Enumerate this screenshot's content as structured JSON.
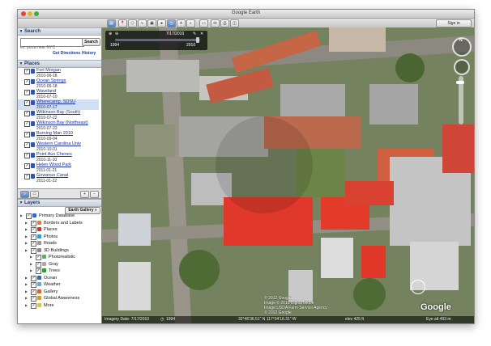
{
  "window": {
    "title": "Google Earth",
    "sign_in": "Sign in"
  },
  "search": {
    "header": "Search",
    "placeholder": "",
    "button": "Search",
    "hint": "ex: pizza near NYC",
    "get_directions": "Get Directions",
    "history": "History"
  },
  "places": {
    "header": "Places",
    "items": [
      {
        "name": "Fort Morgan",
        "date": "2010-06-18"
      },
      {
        "name": "Ocean Springs",
        "date": "2010-06-18"
      },
      {
        "name": "Waveland",
        "date": "2010-07-10"
      },
      {
        "name": "Wherecamp, SDSU",
        "date": "2010-07-17",
        "selected": true
      },
      {
        "name": "Wilkinson Bay (South)",
        "date": "2010-07-22"
      },
      {
        "name": "Wilkinson Bay (Northeast)",
        "date": "2010-07-22"
      },
      {
        "name": "Burning Man 2010",
        "date": "2010-09-04"
      },
      {
        "name": "Western Carolina Univ",
        "date": "2010-10-01"
      },
      {
        "name": "Point Aux Chenes",
        "date": "2010-11-10"
      },
      {
        "name": "Helen Wood Park",
        "date": "2011-01-21"
      },
      {
        "name": "Gowanus Canal",
        "date": "2011-01-22"
      }
    ]
  },
  "layers": {
    "header": "Layers",
    "gallery_button": "Earth Gallery »",
    "items": [
      {
        "label": "Primary Database",
        "level": 0,
        "icon_color": "#3366cc"
      },
      {
        "label": "Borders and Labels",
        "level": 1,
        "icon_color": "#cc8833"
      },
      {
        "label": "Places",
        "level": 1,
        "icon_color": "#cc3333"
      },
      {
        "label": "Photos",
        "level": 1,
        "icon_color": "#3399cc"
      },
      {
        "label": "Roads",
        "level": 1,
        "icon_color": "#999999"
      },
      {
        "label": "3D Buildings",
        "level": 1,
        "icon_color": "#888888"
      },
      {
        "label": "Photorealistic",
        "level": 2,
        "icon_color": "#66aa66"
      },
      {
        "label": "Gray",
        "level": 2,
        "icon_color": "#aaaaaa"
      },
      {
        "label": "Trees",
        "level": 2,
        "icon_color": "#339933"
      },
      {
        "label": "Ocean",
        "level": 1,
        "icon_color": "#3366aa"
      },
      {
        "label": "Weather",
        "level": 1,
        "icon_color": "#66aacc"
      },
      {
        "label": "Gallery",
        "level": 1,
        "icon_color": "#cc6633"
      },
      {
        "label": "Global Awareness",
        "level": 1,
        "icon_color": "#cc9933"
      },
      {
        "label": "More",
        "level": 1,
        "icon_color": "#cccc33"
      }
    ]
  },
  "time_slider": {
    "date": "7/17/2010",
    "start_year": "1994",
    "end_year": "2010"
  },
  "status": {
    "imagery_date": "Imagery Date: 7/17/2010",
    "year": "1994",
    "coords": "32°46'36.51\" N 117°04'16.31\" W",
    "elev": "elev 425 ft",
    "eye_alt": "Eye alt 493 m"
  },
  "copyright": {
    "line1": "© 2012 Google",
    "line2": "Image © 2012 Digital Globe",
    "line3": "Image USDA Farm Service Agency",
    "line4": "© 2012 Google"
  },
  "logo_text": "Google",
  "nav": {
    "north": "N"
  },
  "toolbar_icons": [
    "sidebar-toggle-icon",
    "placemark-icon",
    "polygon-icon",
    "path-icon",
    "overlay-icon",
    "tour-icon",
    "historical-imagery-icon",
    "sun-icon",
    "planets-icon",
    "ruler-icon",
    "email-icon",
    "print-icon",
    "maps-icon"
  ]
}
